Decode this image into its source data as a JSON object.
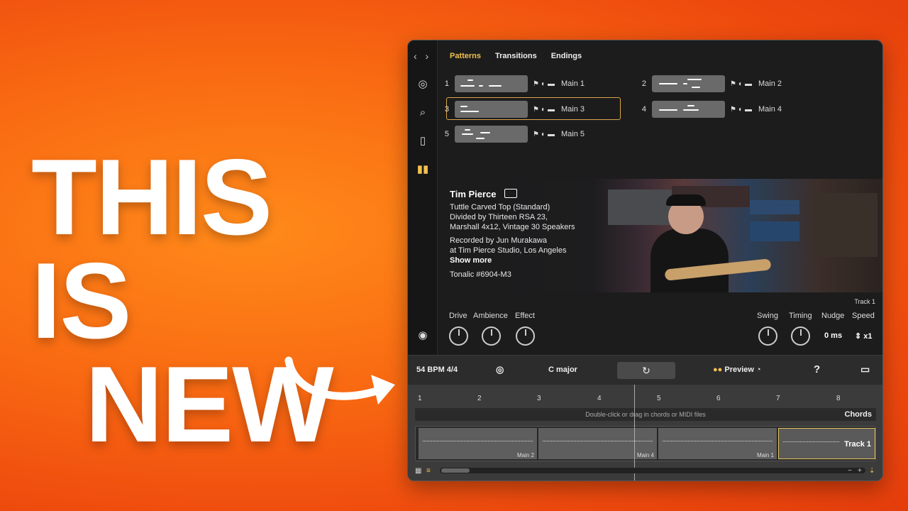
{
  "headline": {
    "line1": "THIS IS",
    "line2": "NEW"
  },
  "tabs": [
    {
      "label": "Patterns",
      "active": true
    },
    {
      "label": "Transitions",
      "active": false
    },
    {
      "label": "Endings",
      "active": false
    }
  ],
  "patterns": [
    {
      "num": "1",
      "label": "Main 1"
    },
    {
      "num": "2",
      "label": "Main 2"
    },
    {
      "num": "3",
      "label": "Main 3",
      "selected": true
    },
    {
      "num": "4",
      "label": "Main 4"
    },
    {
      "num": "5",
      "label": "Main 5"
    }
  ],
  "artist": {
    "name": "Tim Pierce",
    "lines": [
      "Tuttle Carved Top (Standard)",
      "Divided by Thirteen RSA 23,",
      "Marshall 4x12, Vintage 30 Speakers",
      "Recorded by Jun Murakawa",
      "at Tim Pierce Studio, Los Angeles"
    ],
    "show_more": "Show more",
    "code": "Tonalic #6904-M3",
    "track_tag": "Track 1"
  },
  "controls": {
    "left": [
      "Drive",
      "Ambience",
      "Effect"
    ],
    "right": [
      "Swing",
      "Timing",
      "Nudge",
      "Speed"
    ],
    "nudge_value": "0 ms",
    "speed_value": "x1"
  },
  "toolbar": {
    "tempo": "54 BPM  4/4",
    "key": "C major",
    "preview": "Preview",
    "help": "?"
  },
  "timeline": {
    "ruler": [
      "1",
      "2",
      "3",
      "4",
      "5",
      "6",
      "7",
      "8"
    ],
    "chords_hint": "Double-click or drag in chords or MIDI files",
    "chords_label": "Chords",
    "clips": [
      "Main 2",
      "Main 4",
      "Main 1"
    ],
    "track_name": "Track 1"
  },
  "colors": {
    "accent": "#f2c14e",
    "background": "#ee4a0e",
    "panel": "#1c1c1c"
  }
}
